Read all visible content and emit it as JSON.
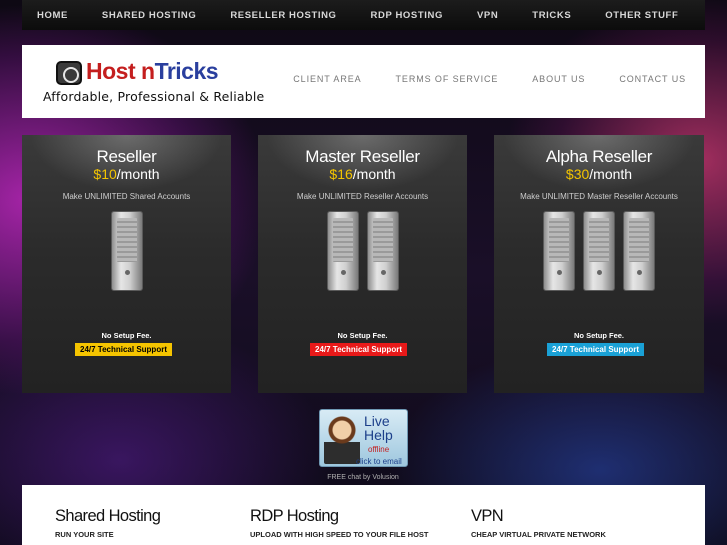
{
  "top_nav": {
    "items": [
      "HOME",
      "SHARED HOSTING",
      "RESELLER HOSTING",
      "RDP HOSTING",
      "VPN",
      "TRICKS",
      "OTHER STUFF"
    ]
  },
  "header": {
    "logo_text_1": "Host n",
    "logo_text_2": "Tricks",
    "tagline": "Affordable, Professional & Reliable",
    "nav": [
      "CLIENT AREA",
      "TERMS OF SERVICE",
      "ABOUT US",
      "CONTACT US"
    ]
  },
  "plans": [
    {
      "title": "Reseller",
      "price": "$10",
      "period": "/month",
      "description": "Make UNLIMITED Shared Accounts",
      "server_count": 1,
      "fee": "No Setup Fee.",
      "support": "24/7 Technical Support",
      "support_bg": "#f5c400",
      "support_fg": "#000000"
    },
    {
      "title": "Master Reseller",
      "price": "$16",
      "period": "/month",
      "description": "Make UNLIMITED Reseller Accounts",
      "server_count": 2,
      "fee": "No Setup Fee.",
      "support": "24/7 Technical Support",
      "support_bg": "#e81919",
      "support_fg": "#ffffff"
    },
    {
      "title": "Alpha Reseller",
      "price": "$30",
      "period": "/month",
      "description": "Make UNLIMITED Master Reseller Accounts",
      "server_count": 3,
      "fee": "No Setup Fee.",
      "support": "24/7 Technical Support",
      "support_bg": "#1aa1d6",
      "support_fg": "#ffffff"
    }
  ],
  "live_help": {
    "title_1": "Live",
    "title_2": "Help",
    "status": "offline",
    "action": "click to email",
    "caption": "FREE chat by Volusion"
  },
  "features": [
    {
      "title": "Shared Hosting",
      "subtitle": "RUN YOUR SITE"
    },
    {
      "title": "RDP Hosting",
      "subtitle": "UPLOAD WITH HIGH SPEED TO YOUR FILE HOST"
    },
    {
      "title": "VPN",
      "subtitle": "CHEAP VIRTUAL PRIVATE NETWORK"
    }
  ],
  "colors": {
    "price": "#f3c400",
    "logo_red": "#c41e1e",
    "logo_blue": "#2a3f9e"
  }
}
